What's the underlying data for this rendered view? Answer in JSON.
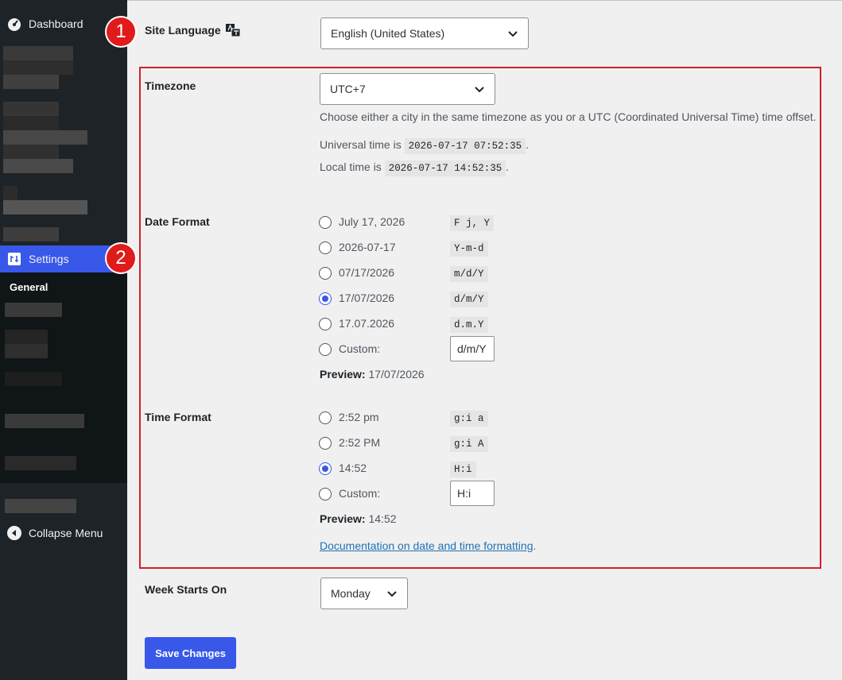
{
  "sidebar": {
    "dashboard_label": "Dashboard",
    "settings_label": "Settings",
    "general_label": "General",
    "collapse_label": "Collapse Menu",
    "active_color": "#3858e9"
  },
  "badges": [
    "1",
    "2"
  ],
  "site_language": {
    "label": "Site Language",
    "value": "English (United States)"
  },
  "timezone": {
    "label": "Timezone",
    "value": "UTC+7",
    "description": "Choose either a city in the same timezone as you or a UTC (Coordinated Universal Time) time offset.",
    "universal_prefix": "Universal time is",
    "universal_value": "2026-07-17 07:52:35",
    "local_prefix": "Local time is",
    "local_value": "2026-07-17 14:52:35",
    "period": "."
  },
  "date_format": {
    "label": "Date Format",
    "options": [
      {
        "label": "July 17, 2026",
        "code": "F j, Y",
        "checked": false
      },
      {
        "label": "2026-07-17",
        "code": "Y-m-d",
        "checked": false
      },
      {
        "label": "07/17/2026",
        "code": "m/d/Y",
        "checked": false
      },
      {
        "label": "17/07/2026",
        "code": "d/m/Y",
        "checked": true
      },
      {
        "label": "17.07.2026",
        "code": "d.m.Y",
        "checked": false
      }
    ],
    "custom_label": "Custom:",
    "custom_value": "d/m/Y",
    "preview_label": "Preview:",
    "preview_value": "17/07/2026"
  },
  "time_format": {
    "label": "Time Format",
    "options": [
      {
        "label": "2:52 pm",
        "code": "g:i a",
        "checked": false
      },
      {
        "label": "2:52 PM",
        "code": "g:i A",
        "checked": false
      },
      {
        "label": "14:52",
        "code": "H:i",
        "checked": true
      }
    ],
    "custom_label": "Custom:",
    "custom_value": "H:i",
    "preview_label": "Preview:",
    "preview_value": "14:52",
    "doc_link": "Documentation on date and time formatting",
    "doc_link_suffix": "."
  },
  "week_starts": {
    "label": "Week Starts On",
    "value": "Monday"
  },
  "save_label": "Save Changes"
}
